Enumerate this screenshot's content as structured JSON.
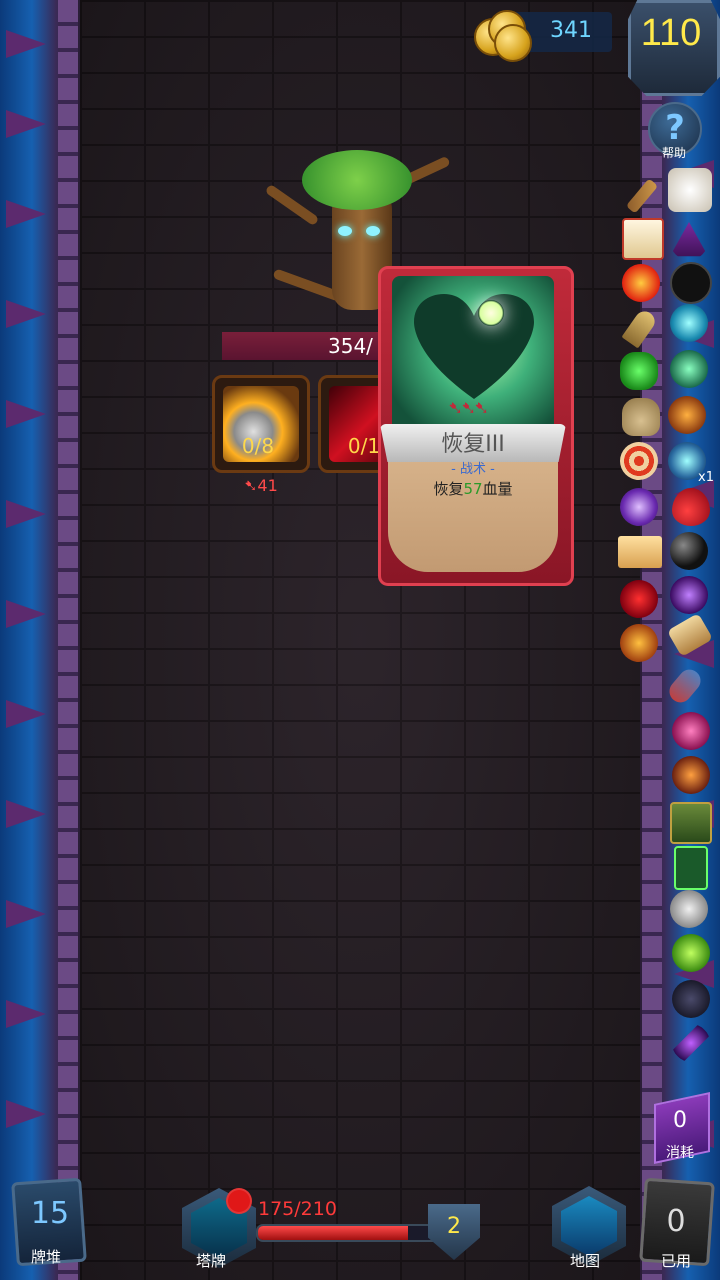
{
  "gold": "341",
  "level": "110",
  "help_label": "帮助",
  "enemy": {
    "hp_text": "354/",
    "intents": [
      {
        "text": "0/8",
        "icon": "blade-attack-icon"
      },
      {
        "text": "0/1",
        "icon": "red-slash-icon"
      }
    ],
    "damage": "41"
  },
  "card": {
    "title": "恢复III",
    "type": "- 战术 -",
    "desc_prefix": "恢复",
    "desc_num": "57",
    "desc_suffix": "血量",
    "cost_icons": "➷➷➷"
  },
  "relics_multiplier": "x1",
  "exhaust": {
    "count": "0",
    "label": "消耗"
  },
  "bottom": {
    "draw_pile": {
      "count": "15",
      "label": "牌堆"
    },
    "deck_label": "塔牌",
    "hp_text": "175/210",
    "hp_fraction": 0.833,
    "energy": "2",
    "map_label": "地图",
    "discard": {
      "count": "0",
      "label": "已用"
    }
  }
}
